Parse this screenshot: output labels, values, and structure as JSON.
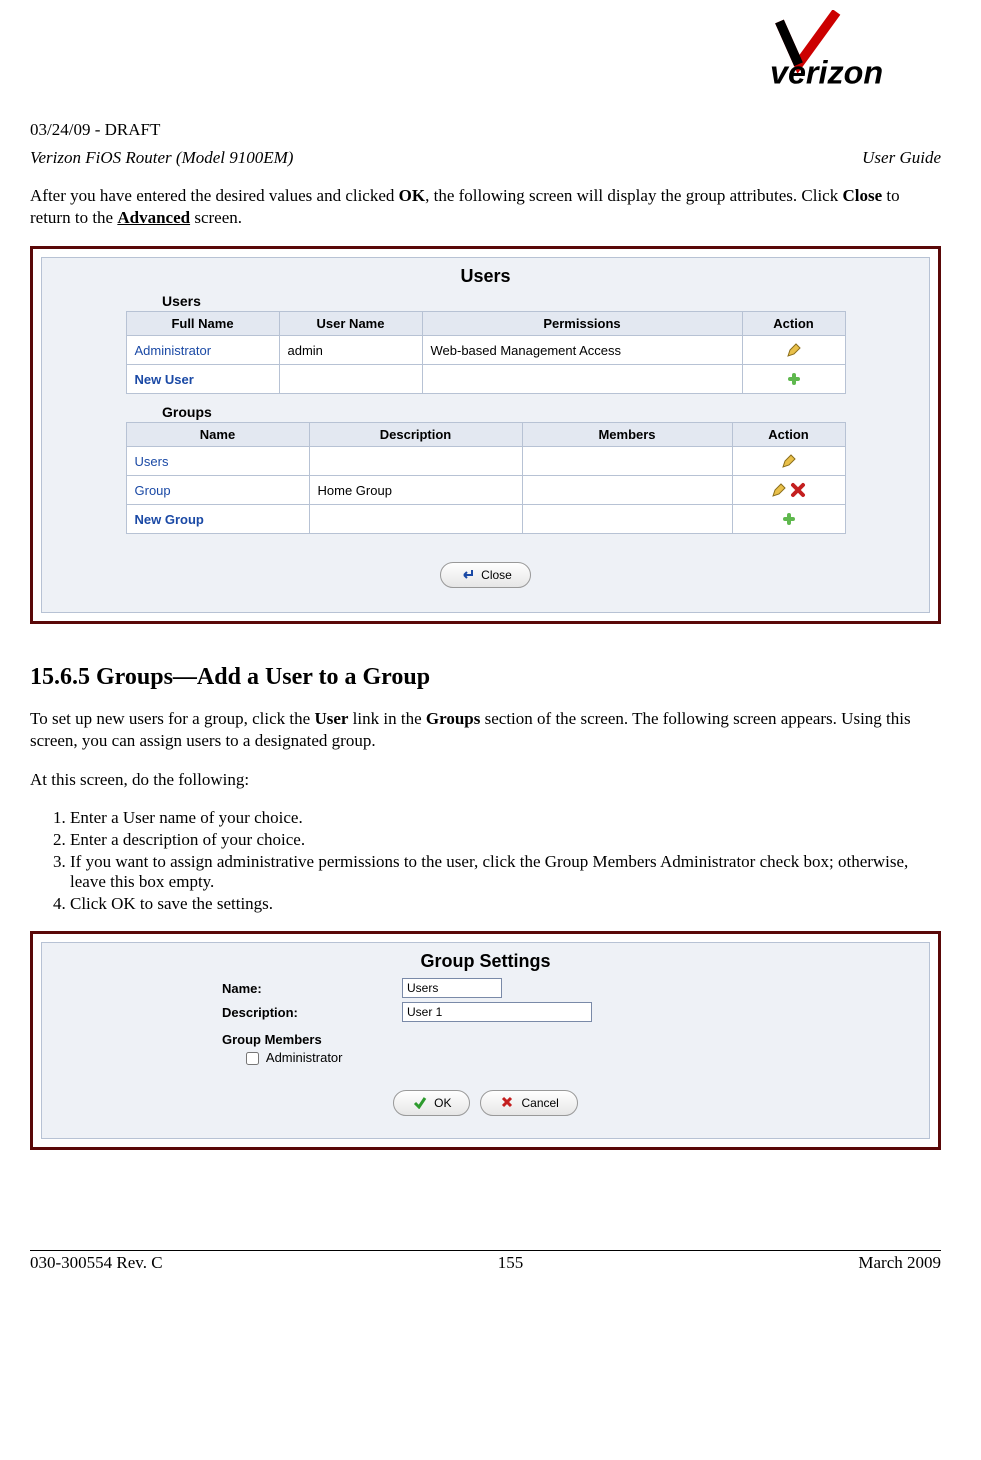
{
  "header": {
    "draft": "03/24/09 - DRAFT",
    "device": "Verizon FiOS Router (Model 9100EM)",
    "doc_type": "User Guide"
  },
  "intro_sentence_parts": {
    "p1": "After you have entered the desired values and clicked ",
    "bold_ok": "OK",
    "p2": ", the following screen will display the group attributes. Click ",
    "bold_close": "Close",
    "p3": " to return to the ",
    "bold_adv": "Advanced",
    "p4": " screen."
  },
  "users_panel": {
    "title": "Users",
    "users_subhead": "Users",
    "groups_subhead": "Groups",
    "users_table": {
      "headers": [
        "Full Name",
        "User Name",
        "Permissions",
        "Action"
      ],
      "rows": [
        {
          "full_name": "Administrator",
          "user_name": "admin",
          "permissions": "Web-based Management Access",
          "actions": [
            "edit"
          ],
          "link_style": "link-blue"
        },
        {
          "full_name": "New User",
          "user_name": "",
          "permissions": "",
          "actions": [
            "add"
          ],
          "link_style": "link-bold-blue"
        }
      ]
    },
    "groups_table": {
      "headers": [
        "Name",
        "Description",
        "Members",
        "Action"
      ],
      "rows": [
        {
          "name": "Users",
          "description": "",
          "members": "",
          "actions": [
            "edit"
          ],
          "link_style": "link-blue"
        },
        {
          "name": "Group",
          "description": "Home Group",
          "members": "",
          "actions": [
            "edit",
            "delete"
          ],
          "link_style": "link-blue"
        },
        {
          "name": "New Group",
          "description": "",
          "members": "",
          "actions": [
            "add"
          ],
          "link_style": "link-bold-blue"
        }
      ]
    },
    "close_btn": "Close"
  },
  "section": {
    "number": "15.6.5",
    "title": "Groups—Add a User to a Group",
    "para1_parts": {
      "p1": "To set up new users for a group, click the ",
      "b1": "User",
      "p2": " link in the ",
      "b2": "Groups",
      "p3": " section of the screen. The following screen appears. Using this screen, you can assign users to a designated group."
    },
    "para2": "At this screen, do the following:",
    "steps": [
      {
        "text": "Enter a User name of your choice."
      },
      {
        "text": "Enter a description of your choice."
      },
      {
        "pre": "If you want to assign administrative permissions to the user, click the ",
        "bold": "Group Members Administrator",
        "post": " check box; otherwise, leave this box empty."
      },
      {
        "pre": "Click ",
        "bold": "OK",
        "post": " to save the settings."
      }
    ]
  },
  "group_settings_panel": {
    "title": "Group Settings",
    "name_label": "Name:",
    "name_value": "Users",
    "desc_label": "Description:",
    "desc_value": "User 1",
    "members_head": "Group Members",
    "admin_checkbox_label": "Administrator",
    "ok_btn": "OK",
    "cancel_btn": "Cancel"
  },
  "footer": {
    "left": "030-300554 Rev. C",
    "center": "155",
    "right": "March 2009"
  },
  "brand": {
    "name": "verizon"
  }
}
